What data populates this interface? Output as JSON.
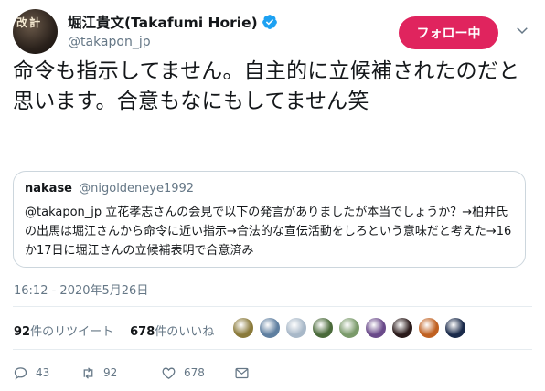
{
  "author": {
    "display_name": "堀江貴文(Takafumi Horie)",
    "handle": "@takapon_jp",
    "avatar_caption": "改 計",
    "verified": true
  },
  "follow_button": {
    "label": "フォロー中"
  },
  "tweet": {
    "text": "命令も指示してません。自主的に立候補されたのだと思います。合意もなにもしてません笑"
  },
  "quoted_tweet": {
    "name": "nakase",
    "handle": "@nigoldeneye1992",
    "text": "@takapon_jp 立花孝志さんの会見で以下の発言がありましたが本当でしょうか？→柏井氏の出馬は堀江さんから命令に近い指示→合法的な宣伝活動をしろという意味だと考えた→16か17日に堀江さんの立候補表明で合意済み"
  },
  "timestamp": "16:12 - 2020年5月26日",
  "stats": {
    "retweets_num": "92",
    "retweets_label": "件のリツイート",
    "likes_num": "678",
    "likes_label": "件のいいね"
  },
  "likers": [
    {
      "color": "#8a7a3a",
      "icon": "avatar-1"
    },
    {
      "color": "#5f7fa0",
      "icon": "avatar-2"
    },
    {
      "color": "#a8b8c8",
      "icon": "avatar-3"
    },
    {
      "color": "#4a6a3a",
      "icon": "avatar-4"
    },
    {
      "color": "#7a9a6a",
      "icon": "avatar-5"
    },
    {
      "color": "#6a4a8a",
      "icon": "avatar-6"
    },
    {
      "color": "#2a1a1a",
      "icon": "avatar-7"
    },
    {
      "color": "#c06020",
      "icon": "avatar-8"
    },
    {
      "color": "#1a2a4a",
      "icon": "avatar-9"
    }
  ],
  "actions": {
    "reply_count": "43",
    "retweet_count": "92",
    "like_count": "678"
  },
  "colors": {
    "follow": "#e0245e",
    "verified": "#1da1f2",
    "secondary_text": "#657786",
    "border": "#ccd6dd"
  }
}
